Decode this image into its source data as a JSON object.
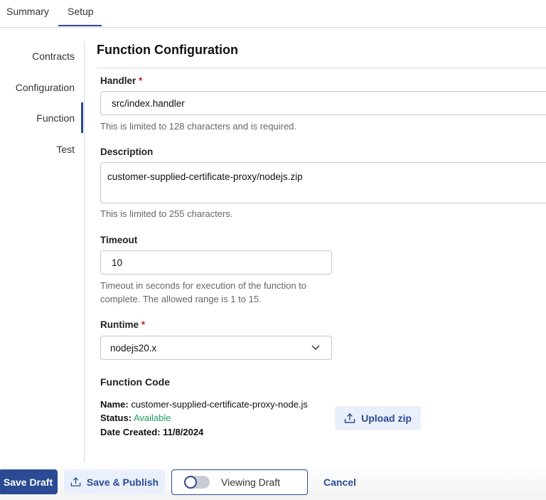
{
  "tabs": [
    {
      "label": "Summary"
    },
    {
      "label": "Setup",
      "active": true
    }
  ],
  "sidebar": {
    "items": [
      {
        "label": "Contracts"
      },
      {
        "label": "Configuration"
      },
      {
        "label": "Function",
        "active": true
      },
      {
        "label": "Test"
      }
    ]
  },
  "main": {
    "title": "Function Configuration",
    "handler": {
      "label": "Handler",
      "required": "*",
      "value": "src/index.handler",
      "help": "This is limited to 128 characters and is required."
    },
    "description": {
      "label": "Description",
      "value": "customer-supplied-certificate-proxy/nodejs.zip",
      "help": "This is limited to 255 characters."
    },
    "timeout": {
      "label": "Timeout",
      "value": "10",
      "help1": "Timeout in seconds for execution of the function to",
      "help2": "complete. The allowed range is 1 to 15."
    },
    "runtime": {
      "label": "Runtime",
      "required": "*",
      "value": "nodejs20.x"
    },
    "function_code": {
      "title": "Function Code",
      "name_label": "Name:",
      "name": "customer-supplied-certificate-proxy-node.js",
      "status_label": "Status:",
      "status": "Available",
      "date_label": "Date Created:",
      "date": "11/8/2024",
      "upload_label": "Upload zip"
    }
  },
  "footer": {
    "save_draft": "Save Draft",
    "save_publish": "Save & Publish",
    "viewing_draft": "Viewing Draft",
    "cancel": "Cancel"
  },
  "colors": {
    "primary": "#2a4a94",
    "status_available": "#1f9d62",
    "required": "#c0202a"
  }
}
